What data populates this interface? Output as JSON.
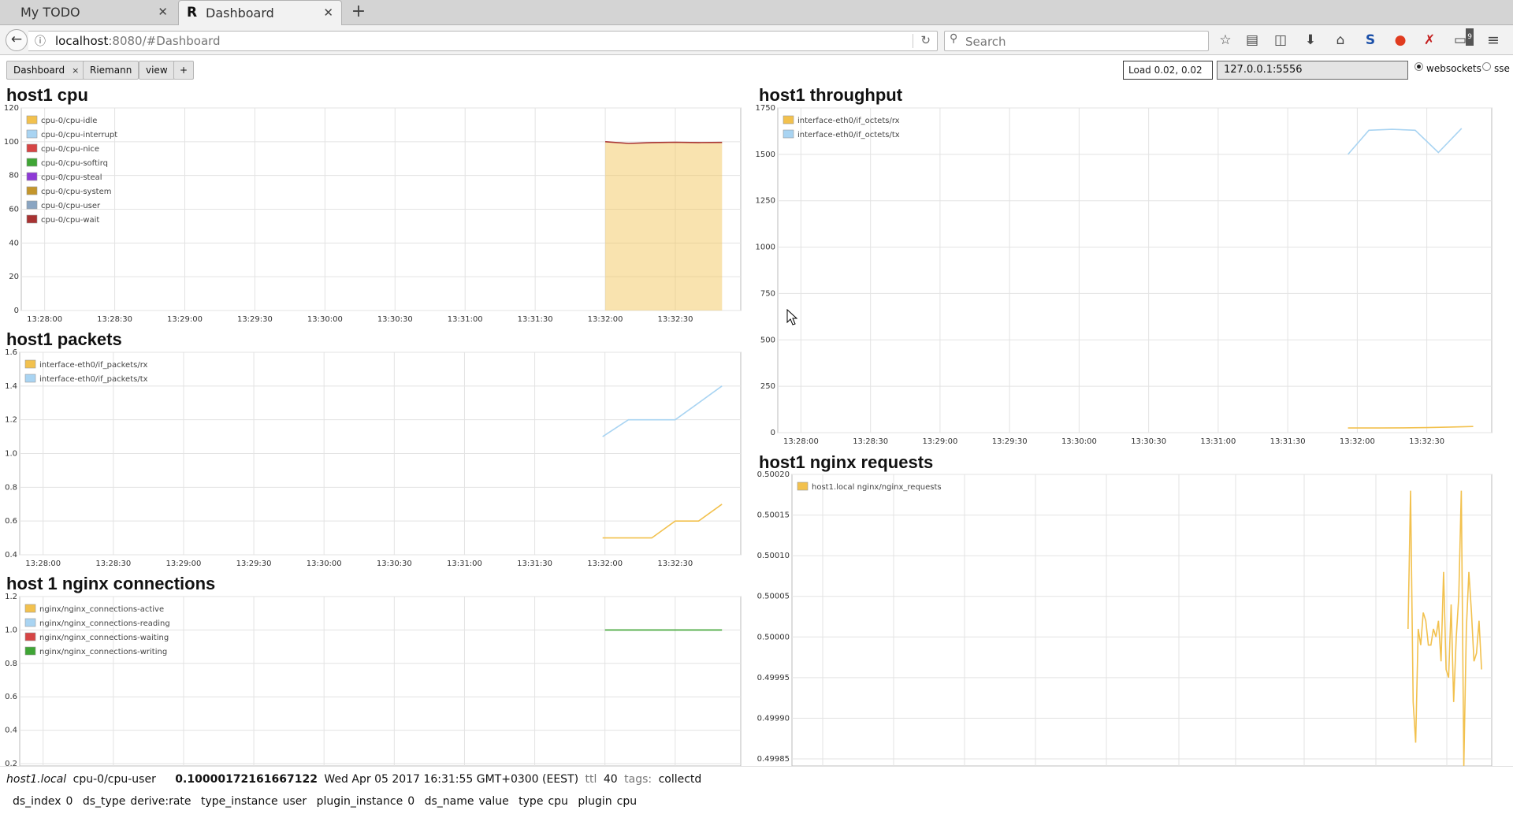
{
  "browser": {
    "tabs": [
      {
        "label": "My TODO",
        "active": false
      },
      {
        "label": "Dashboard",
        "active": true,
        "favicon": "R"
      }
    ],
    "url": {
      "host": "localhost",
      "rest": ":8080/#Dashboard"
    },
    "search_placeholder": "Search",
    "toolbar_icons": [
      "bookmark-star-icon",
      "reading-list-icon",
      "pocket-icon",
      "download-icon",
      "home-icon",
      "s-extension-icon",
      "tomato-icon",
      "red-extension-icon",
      "monitor-badge-icon",
      "hamburger-menu-icon"
    ],
    "badge": "9"
  },
  "dashboard": {
    "tabs": [
      {
        "label": "Dashboard",
        "close": "×"
      },
      {
        "label": "Riemann"
      },
      {
        "label": "view"
      },
      {
        "label": "+"
      }
    ],
    "load": "Load 0.02, 0.02",
    "server": "127.0.0.1:5556",
    "transport": [
      {
        "label": "websockets",
        "selected": true
      },
      {
        "label": "sse",
        "selected": false
      }
    ]
  },
  "panels": {
    "cpu_title": "host1 cpu",
    "packets_title": "host1 packets",
    "connections_title": "host 1 nginx connections",
    "throughput_title": "host1 throughput",
    "requests_title": "host1 nginx requests"
  },
  "chart_data": [
    {
      "id": "cpu",
      "type": "area",
      "title": "host1 cpu",
      "ylim": [
        0,
        120
      ],
      "yticks": [
        "0",
        "20",
        "40",
        "60",
        "80",
        "100",
        "120"
      ],
      "xticks": [
        "13:28:00",
        "13:28:30",
        "13:29:00",
        "13:29:30",
        "13:30:00",
        "13:30:30",
        "13:31:00",
        "13:31:30",
        "13:32:00",
        "13:32:30"
      ],
      "grid": true,
      "legend": "top-left",
      "series": [
        {
          "name": "cpu-0/cpu-idle",
          "color": "#f2c14e",
          "x": [
            "13:32:00",
            "13:32:10",
            "13:32:20",
            "13:32:30",
            "13:32:40",
            "13:32:50"
          ],
          "y": [
            100,
            99,
            99.5,
            99.7,
            99.5,
            99.6
          ]
        },
        {
          "name": "cpu-0/cpu-interrupt",
          "color": "#a9d4f2",
          "x": [],
          "y": []
        },
        {
          "name": "cpu-0/cpu-nice",
          "color": "#d64545",
          "x": [],
          "y": []
        },
        {
          "name": "cpu-0/cpu-softirq",
          "color": "#3fa535",
          "x": [],
          "y": []
        },
        {
          "name": "cpu-0/cpu-steal",
          "color": "#8e3ad6",
          "x": [],
          "y": []
        },
        {
          "name": "cpu-0/cpu-system",
          "color": "#c4962c",
          "x": [],
          "y": []
        },
        {
          "name": "cpu-0/cpu-user",
          "color": "#8aa5c2",
          "x": [],
          "y": []
        },
        {
          "name": "cpu-0/cpu-wait",
          "color": "#a83232",
          "x": [
            "13:32:00",
            "13:32:10",
            "13:32:20",
            "13:32:30",
            "13:32:40",
            "13:32:50"
          ],
          "y": [
            100,
            99,
            99.5,
            99.7,
            99.5,
            99.6
          ]
        }
      ]
    },
    {
      "id": "packets",
      "type": "line",
      "title": "host1 packets",
      "ylim": [
        0.4,
        1.6
      ],
      "yticks": [
        "0.4",
        "0.6",
        "0.8",
        "1.0",
        "1.2",
        "1.4",
        "1.6"
      ],
      "xticks": [
        "13:28:00",
        "13:28:30",
        "13:29:00",
        "13:29:30",
        "13:30:00",
        "13:30:30",
        "13:31:00",
        "13:31:30",
        "13:32:00",
        "13:32:30"
      ],
      "grid": true,
      "legend": "top-left",
      "series": [
        {
          "name": "interface-eth0/if_packets/rx",
          "color": "#f2c14e",
          "x": [
            "13:31:59",
            "13:32:10",
            "13:32:20",
            "13:32:30",
            "13:32:40",
            "13:32:50"
          ],
          "y": [
            0.5,
            0.5,
            0.5,
            0.6,
            0.6,
            0.7
          ]
        },
        {
          "name": "interface-eth0/if_packets/tx",
          "color": "#a9d4f2",
          "x": [
            "13:31:59",
            "13:32:10",
            "13:32:20",
            "13:32:30",
            "13:32:40",
            "13:32:50"
          ],
          "y": [
            1.1,
            1.2,
            1.2,
            1.2,
            1.3,
            1.4
          ]
        }
      ]
    },
    {
      "id": "connections",
      "type": "line",
      "title": "host 1 nginx connections",
      "ylim": [
        0.2,
        1.2
      ],
      "yticks": [
        "0.2",
        "0.4",
        "0.6",
        "0.8",
        "1.0",
        "1.2"
      ],
      "xticks": [],
      "grid": true,
      "legend": "top-left",
      "series": [
        {
          "name": "nginx/nginx_connections-active",
          "color": "#f2c14e",
          "x": [],
          "y": []
        },
        {
          "name": "nginx/nginx_connections-reading",
          "color": "#a9d4f2",
          "x": [],
          "y": []
        },
        {
          "name": "nginx/nginx_connections-waiting",
          "color": "#d64545",
          "x": [],
          "y": []
        },
        {
          "name": "nginx/nginx_connections-writing",
          "color": "#3fa535",
          "x": [
            "13:32:00",
            "13:32:50"
          ],
          "y": [
            1.0,
            1.0
          ]
        }
      ]
    },
    {
      "id": "throughput",
      "type": "line",
      "title": "host1 throughput",
      "ylim": [
        0,
        1750
      ],
      "yticks": [
        "0",
        "250",
        "500",
        "750",
        "1000",
        "1250",
        "1500",
        "1750"
      ],
      "xticks": [
        "13:28:00",
        "13:28:30",
        "13:29:00",
        "13:29:30",
        "13:30:00",
        "13:30:30",
        "13:31:00",
        "13:31:30",
        "13:32:00",
        "13:32:30"
      ],
      "grid": true,
      "legend": "top-left",
      "series": [
        {
          "name": "interface-eth0/if_octets/rx",
          "color": "#f2c14e",
          "x": [
            "13:31:56",
            "13:32:10",
            "13:32:20",
            "13:32:30",
            "13:32:40",
            "13:32:50"
          ],
          "y": [
            25,
            25,
            26,
            27,
            30,
            33
          ]
        },
        {
          "name": "interface-eth0/if_octets/tx",
          "color": "#a9d4f2",
          "x": [
            "13:31:56",
            "13:32:05",
            "13:32:15",
            "13:32:25",
            "13:32:35",
            "13:32:45"
          ],
          "y": [
            1500,
            1630,
            1635,
            1630,
            1510,
            1640
          ]
        }
      ]
    },
    {
      "id": "requests",
      "type": "line",
      "title": "host1 nginx requests",
      "ylim": [
        0.49985,
        0.5002
      ],
      "yticks": [
        "0.49985",
        "0.49990",
        "0.49995",
        "0.50000",
        "0.50005",
        "0.50010",
        "0.50015",
        "0.50020"
      ],
      "xticks": [],
      "grid": true,
      "legend": "top-left",
      "series": [
        {
          "name": "host1.local nginx/nginx_requests",
          "color": "#f2c14e",
          "x": [
            "13:31:53",
            "13:31:54",
            "13:31:55",
            "13:31:56",
            "13:31:57",
            "13:31:58",
            "13:31:59",
            "13:32:00",
            "13:32:01",
            "13:32:02",
            "13:32:03",
            "13:32:04",
            "13:32:05",
            "13:32:06",
            "13:32:07",
            "13:32:08",
            "13:32:09",
            "13:32:10",
            "13:32:11",
            "13:32:12",
            "13:32:13",
            "13:32:14",
            "13:32:15",
            "13:32:16",
            "13:32:17",
            "13:32:18",
            "13:32:19",
            "13:32:20",
            "13:32:21",
            "13:32:22"
          ],
          "y": [
            0.50001,
            0.50018,
            0.49992,
            0.49987,
            0.50001,
            0.49999,
            0.50003,
            0.50002,
            0.49999,
            0.49999,
            0.50001,
            0.5,
            0.50002,
            0.49997,
            0.50008,
            0.49996,
            0.49995,
            0.50004,
            0.49992,
            0.5,
            0.50005,
            0.50018,
            0.49984,
            0.50001,
            0.50008,
            0.50003,
            0.49997,
            0.49998,
            0.50002,
            0.49996
          ]
        }
      ]
    }
  ],
  "status": {
    "host": "host1.local",
    "service": "cpu-0/cpu-user",
    "metric": "0.10000172161667122",
    "time": "Wed Apr 05 2017 16:31:55 GMT+0300 (EEST)",
    "ttl_label": "ttl",
    "ttl": "40",
    "tags_label": "tags:",
    "tags": "collectd",
    "attributes": [
      {
        "key": "ds_index",
        "value": "0"
      },
      {
        "key": "ds_type",
        "value": "derive:rate"
      },
      {
        "key": "type_instance",
        "value": "user"
      },
      {
        "key": "plugin_instance",
        "value": "0"
      },
      {
        "key": "ds_name",
        "value": "value"
      },
      {
        "key": "type",
        "value": "cpu"
      },
      {
        "key": "plugin",
        "value": "cpu"
      }
    ]
  }
}
